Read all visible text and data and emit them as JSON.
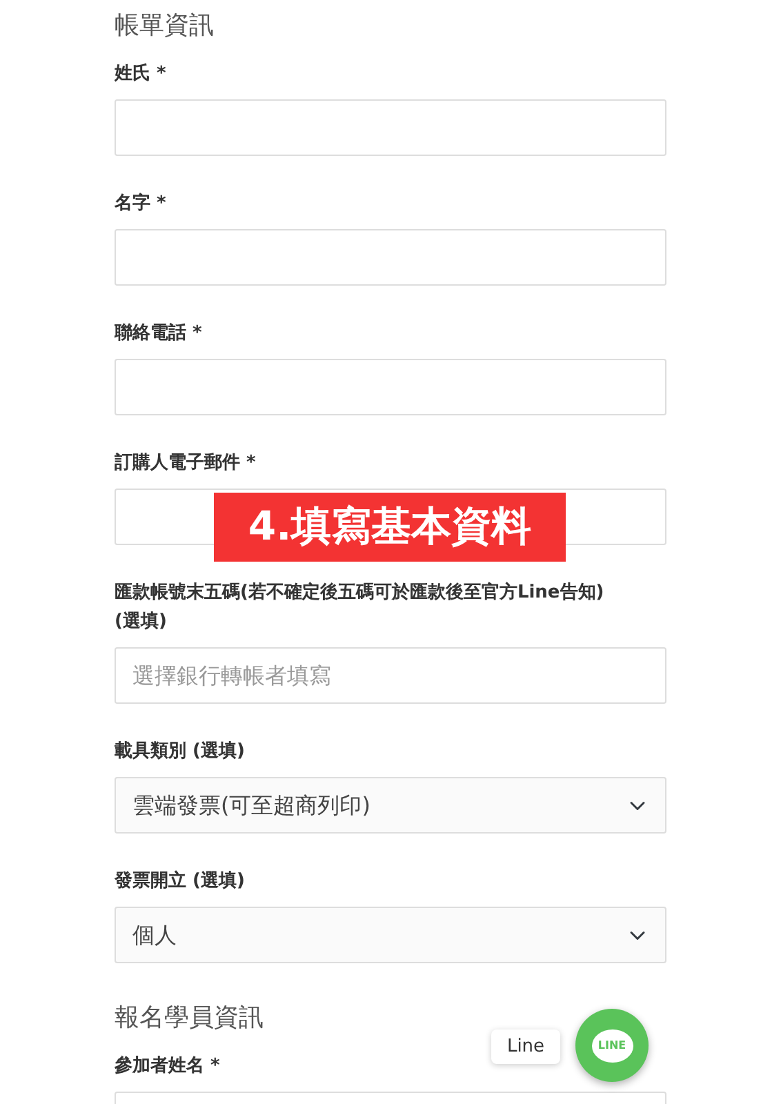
{
  "form": [
    {
      "kind": "heading",
      "text": "帳單資訊"
    },
    {
      "kind": "text",
      "label": "姓氏 *"
    },
    {
      "kind": "text",
      "label": "名字 *"
    },
    {
      "kind": "text",
      "label": "聯絡電話 *"
    },
    {
      "kind": "text",
      "label": "訂購人電子郵件 *"
    },
    {
      "kind": "text",
      "label": "匯款帳號末五碼(若不確定後五碼可於匯款後至官方Line告知) (選填)",
      "placeholder": "選擇銀行轉帳者填寫"
    },
    {
      "kind": "select",
      "label": "載具類別 (選填)",
      "value": "雲端發票(可至超商列印)"
    },
    {
      "kind": "select",
      "label": "發票開立 (選填)",
      "value": "個人"
    },
    {
      "kind": "heading",
      "text": "報名學員資訊"
    },
    {
      "kind": "text",
      "label": "參加者姓名 *"
    }
  ],
  "banner": "4.填寫基本資料",
  "chat": {
    "tooltip": "Line",
    "logo": "LINE"
  }
}
